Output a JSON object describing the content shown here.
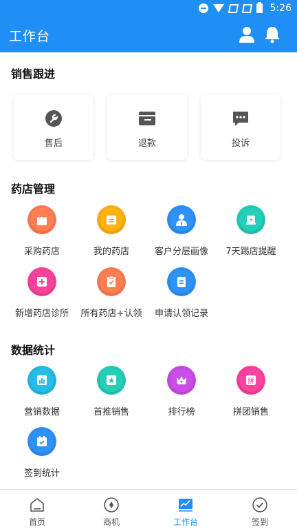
{
  "status_bar": {
    "time": "5:26"
  },
  "app_bar": {
    "title": "工作台",
    "icons": [
      "user-icon",
      "bell-icon"
    ]
  },
  "sales_followup": {
    "title": "销售跟进",
    "items": [
      {
        "label": "售后",
        "icon": "wrench-icon"
      },
      {
        "label": "退款",
        "icon": "wallet-icon"
      },
      {
        "label": "投诉",
        "icon": "chat-icon"
      }
    ]
  },
  "pharmacy_mgmt": {
    "title": "药店管理",
    "items": [
      {
        "label": "采购药店",
        "icon": "shopping-bag-icon",
        "color": "#f97a52"
      },
      {
        "label": "我的药店",
        "icon": "store-icon",
        "color": "#f8ae12"
      },
      {
        "label": "客户分层画像",
        "icon": "customer-profile-icon",
        "color": "#2d8ef0"
      },
      {
        "label": "7天踢店提醒",
        "icon": "alert-icon",
        "color": "#23c9b4"
      },
      {
        "label": "新增药店诊所",
        "icon": "add-clinic-icon",
        "color": "#f5409a"
      },
      {
        "label": "所有药店+认领",
        "icon": "claim-icon",
        "color": "#f97a52"
      },
      {
        "label": "申请认领记录",
        "icon": "record-icon",
        "color": "#2d8ef0"
      }
    ]
  },
  "data_stats": {
    "title": "数据统计",
    "items": [
      {
        "label": "营销数据",
        "icon": "bar-chart-icon",
        "color": "#23b8e0"
      },
      {
        "label": "首推销售",
        "icon": "star-icon",
        "color": "#23c9b4"
      },
      {
        "label": "排行榜",
        "icon": "crown-icon",
        "color": "#c34be0"
      },
      {
        "label": "拼团销售",
        "icon": "group-buy-icon",
        "color": "#f5409a"
      },
      {
        "label": "签到统计",
        "icon": "checkin-calendar-icon",
        "color": "#2d8ef0"
      }
    ]
  },
  "group_buy_glyph": "拼",
  "bottom_nav": {
    "items": [
      {
        "label": "首页",
        "icon": "home-icon"
      },
      {
        "label": "商机",
        "icon": "opportunity-icon"
      },
      {
        "label": "工作台",
        "icon": "workbench-icon",
        "active": true
      },
      {
        "label": "签到",
        "icon": "checkin-icon"
      }
    ],
    "active_color": "#1f8ef5"
  },
  "theme": {
    "primary": "#1f8ef5"
  }
}
